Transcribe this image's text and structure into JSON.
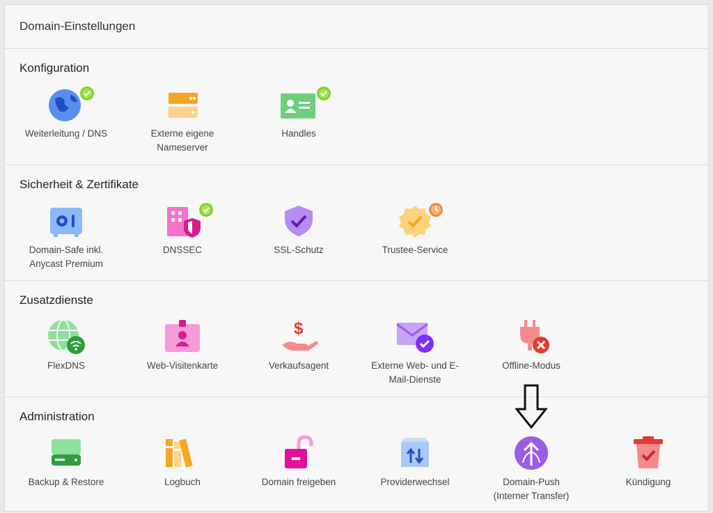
{
  "header": {
    "title": "Domain-Einstellungen"
  },
  "sections": [
    {
      "title": "Konfiguration",
      "items": [
        {
          "label": "Weiterleitung / DNS",
          "icon": "globe-icon",
          "badge": "check-badge-icon"
        },
        {
          "label": "Externe eigene\nNameserver",
          "icon": "server-icon"
        },
        {
          "label": "Handles",
          "icon": "contact-card-icon",
          "badge": "check-badge-icon"
        }
      ]
    },
    {
      "title": "Sicherheit & Zertifikate",
      "items": [
        {
          "label": "Domain-Safe inkl.\nAnycast Premium",
          "icon": "safe-icon"
        },
        {
          "label": "DNSSEC",
          "icon": "shield-building-icon",
          "badge": "check-badge-icon"
        },
        {
          "label": "SSL-Schutz",
          "icon": "ssl-shield-icon"
        },
        {
          "label": "Trustee-Service",
          "icon": "trustee-seal-icon",
          "badge": "clock-badge-icon"
        }
      ]
    },
    {
      "title": "Zusatzdienste",
      "items": [
        {
          "label": "FlexDNS",
          "icon": "flexdns-globe-icon"
        },
        {
          "label": "Web-Visitenkarte",
          "icon": "id-badge-icon"
        },
        {
          "label": "Verkaufsagent",
          "icon": "hand-dollar-icon"
        },
        {
          "label": "Externe Web- und E-\nMail-Dienste",
          "icon": "mail-check-icon"
        },
        {
          "label": "Offline-Modus",
          "icon": "plug-off-icon"
        }
      ]
    },
    {
      "title": "Administration",
      "items": [
        {
          "label": "Backup & Restore",
          "icon": "backup-drive-icon"
        },
        {
          "label": "Logbuch",
          "icon": "books-icon"
        },
        {
          "label": "Domain freigeben",
          "icon": "unlock-icon"
        },
        {
          "label": "Providerwechsel",
          "icon": "transfer-box-icon"
        },
        {
          "label": "Domain-Push\n(Interner Transfer)",
          "icon": "push-arrow-icon"
        },
        {
          "label": "Kündigung",
          "icon": "trash-icon"
        }
      ]
    }
  ],
  "colors": {
    "check": "#7ed321",
    "clock": "#f0883e",
    "error": "#e53935",
    "purple": "#9b5de5",
    "pink": "#e040a0"
  }
}
